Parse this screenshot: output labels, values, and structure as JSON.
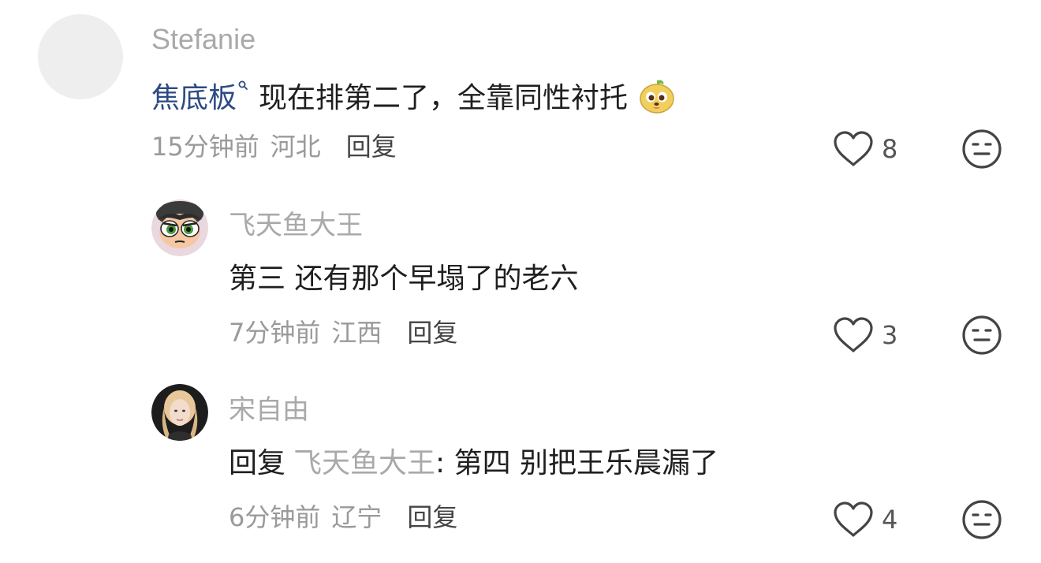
{
  "comments": [
    {
      "username": "Stefanie",
      "content_link": "焦底板",
      "content_text": "现在排第二了，全靠同性衬托",
      "time": "15分钟前",
      "location": "河北",
      "reply_label": "回复",
      "like_count": "8",
      "emoji_icon": "puppy-emoji-icon"
    },
    {
      "username": "飞天鱼大王",
      "content_text": "第三 还有那个早塌了的老六",
      "time": "7分钟前",
      "location": "江西",
      "reply_label": "回复",
      "like_count": "3"
    },
    {
      "username": "宋自由",
      "reply_prefix": "回复",
      "reply_target": "飞天鱼大王",
      "content_text": ": 第四 别把王乐晨漏了",
      "time": "6分钟前",
      "location": "辽宁",
      "reply_label": "回复",
      "like_count": "4"
    }
  ],
  "colors": {
    "username": "#a9a9a9",
    "link": "#2d4a84",
    "text": "#1f1f1f",
    "meta": "#9a9a9a",
    "icon_stroke": "#444444"
  }
}
